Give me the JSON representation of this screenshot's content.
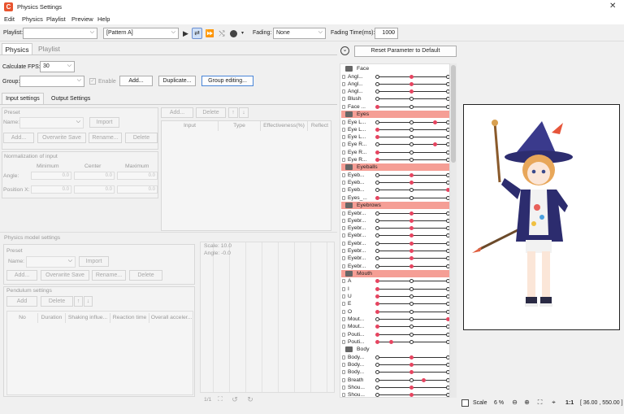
{
  "window": {
    "title": "Physics Settings",
    "close": "✕"
  },
  "menu": [
    "Edit",
    "Physics",
    "Playlist",
    "Preview",
    "Help"
  ],
  "toolbar": {
    "playlist_label": "Playlist:",
    "playlist_value": "",
    "pattern_value": "[Pattern A]",
    "fading_label": "Fading:",
    "fading_value": "None",
    "fading_time_label": "Fading Time(ms):",
    "fading_time_value": "1000"
  },
  "tabs": {
    "physics": "Physics",
    "playlist": "Playlist"
  },
  "fps": {
    "label": "Calculate FPS:",
    "value": "30"
  },
  "group": {
    "label": "Group:",
    "value": "",
    "enable": "Enable",
    "add": "Add...",
    "duplicate": "Duplicate...",
    "editing": "Group editing..."
  },
  "subtabs": {
    "input": "Input settings",
    "output": "Output Settings"
  },
  "preset": {
    "title": "Preset",
    "name_label": "Name:",
    "import": "Import",
    "add": "Add...",
    "overwrite": "Overwrite Save",
    "rename": "Rename...",
    "delete": "Delete"
  },
  "input_toolbar": {
    "add": "Add...",
    "delete": "Delete",
    "up": "↑",
    "down": "↓"
  },
  "input_cols": [
    "Input",
    "Type",
    "Effectiveness(%)",
    "Reflect"
  ],
  "normalization": {
    "title": "Normalization of input",
    "min": "Minimum",
    "center": "Center",
    "max": "Maximum",
    "angle": "Angle:",
    "position": "Position X:",
    "v": "0.0"
  },
  "model": {
    "title": "Physics model settings",
    "preset": "Preset",
    "name_label": "Name:",
    "import": "Import",
    "add": "Add...",
    "overwrite": "Overwrite Save",
    "rename": "Rename...",
    "delete": "Delete"
  },
  "pendulum": {
    "title": "Pendulum settings",
    "add": "Add",
    "delete": "Delete",
    "up": "↑",
    "down": "↓",
    "cols": [
      "No",
      "Duration",
      "Shaking influe...",
      "Reaction time",
      "Overall acceler..."
    ]
  },
  "scale_panel": {
    "scale": "Scale: 10.0",
    "angle": "Angle: -0.0",
    "page": "1/1"
  },
  "reset_button": "Reset Parameter to Default",
  "groups": [
    {
      "name": "Face",
      "hl": false,
      "rows": [
        {
          "n": "Angl...",
          "d": [
            0.48
          ]
        },
        {
          "n": "Angl...",
          "d": [
            0.48
          ]
        },
        {
          "n": "Angl...",
          "d": [
            0.48
          ]
        },
        {
          "n": "Blush",
          "d": []
        },
        {
          "n": "Face ...",
          "d": [
            0
          ]
        }
      ]
    },
    {
      "name": "Eyes",
      "hl": true,
      "rows": [
        {
          "n": "Eye L...",
          "d": [
            0.82
          ]
        },
        {
          "n": "Eye L...",
          "d": [
            0
          ]
        },
        {
          "n": "Eye L...",
          "d": [
            0
          ]
        },
        {
          "n": "Eye R...",
          "d": [
            0.82
          ]
        },
        {
          "n": "Eye R...",
          "d": [
            0
          ]
        },
        {
          "n": "Eye R...",
          "d": [
            0
          ]
        }
      ]
    },
    {
      "name": "Eyeballs",
      "hl": true,
      "rows": [
        {
          "n": "Eyeb...",
          "d": [
            0.48
          ]
        },
        {
          "n": "Eyeb...",
          "d": [
            0.48
          ]
        },
        {
          "n": "Eyeb...",
          "d": [
            1
          ]
        },
        {
          "n": "Eyes_...",
          "d": [
            0
          ]
        }
      ]
    },
    {
      "name": "Eyebrows",
      "hl": true,
      "rows": [
        {
          "n": "Eyebr...",
          "d": [
            0.48
          ]
        },
        {
          "n": "Eyebr...",
          "d": [
            0.48
          ]
        },
        {
          "n": "Eyebr...",
          "d": [
            0.48
          ]
        },
        {
          "n": "Eyebr...",
          "d": [
            0.48
          ]
        },
        {
          "n": "Eyebr...",
          "d": [
            0.48
          ]
        },
        {
          "n": "Eyebr...",
          "d": [
            0.48
          ]
        },
        {
          "n": "Eyebr...",
          "d": [
            0.48
          ]
        },
        {
          "n": "Eyebr...",
          "d": [
            0.48
          ]
        }
      ]
    },
    {
      "name": "Mouth",
      "hl": true,
      "rows": [
        {
          "n": "A",
          "d": [
            0
          ]
        },
        {
          "n": "I",
          "d": [
            0
          ]
        },
        {
          "n": "U",
          "d": [
            0
          ]
        },
        {
          "n": "E",
          "d": [
            0
          ]
        },
        {
          "n": "O",
          "d": [
            0
          ]
        },
        {
          "n": "Mout...",
          "d": [
            1
          ]
        },
        {
          "n": "Mout...",
          "d": [
            0
          ]
        },
        {
          "n": "Pouti...",
          "d": [
            0
          ]
        },
        {
          "n": "Pouti...",
          "d": [
            0,
            0.2
          ]
        }
      ]
    },
    {
      "name": "Body",
      "hl": false,
      "rows": [
        {
          "n": "Body...",
          "d": [
            0.48
          ]
        },
        {
          "n": "Body...",
          "d": [
            0.48
          ]
        },
        {
          "n": "Body...",
          "d": [
            0.48
          ]
        },
        {
          "n": "Breath",
          "d": [
            0.65
          ]
        },
        {
          "n": "Shou...",
          "d": [
            0.48
          ]
        },
        {
          "n": "Shou...",
          "d": [
            0.48
          ]
        }
      ]
    }
  ],
  "status": {
    "scale_label": "Scale",
    "zoom": "6 %",
    "ratio": "1:1",
    "coords": "[ 36.00 , 550.00 ]"
  }
}
